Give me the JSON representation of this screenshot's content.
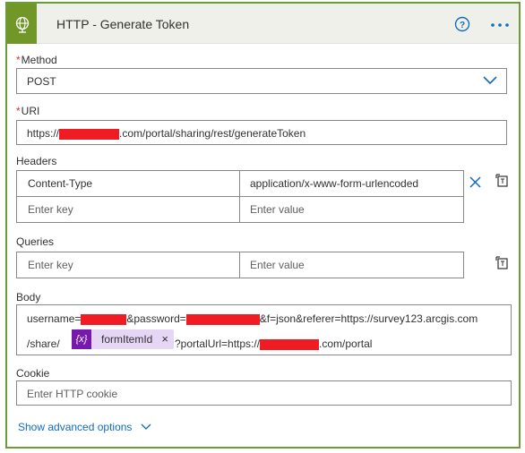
{
  "header": {
    "title": "HTTP - Generate Token",
    "icon": "globe-icon",
    "help_icon": "help-circle-icon",
    "more_icon": "more-ellipsis-icon",
    "accent": "#709727"
  },
  "method": {
    "required_mark": "*",
    "label": "Method",
    "value": "POST"
  },
  "uri": {
    "required_mark": "*",
    "label": "URI",
    "prefix": "https://",
    "suffix": ".com/portal/sharing/rest/generateToken"
  },
  "headers": {
    "label": "Headers",
    "rows": [
      {
        "key": "Content-Type",
        "value": "application/x-www-form-urlencoded"
      }
    ],
    "key_placeholder": "Enter key",
    "value_placeholder": "Enter value"
  },
  "queries": {
    "label": "Queries",
    "key_placeholder": "Enter key",
    "value_placeholder": "Enter value"
  },
  "body": {
    "label": "Body",
    "line1_a": "username=",
    "line1_b": "&password=",
    "line1_c": "&f=json&referer=https://survey123.arcgis.com",
    "line2_a": "/share/",
    "token_icon": "{x}",
    "token_label": "formItemId",
    "token_remove": "×",
    "line2_b": "?portalUrl=https://",
    "line2_c": ".com/portal"
  },
  "cookie": {
    "label": "Cookie",
    "placeholder": "Enter HTTP cookie"
  },
  "advanced": {
    "label": "Show advanced options"
  }
}
